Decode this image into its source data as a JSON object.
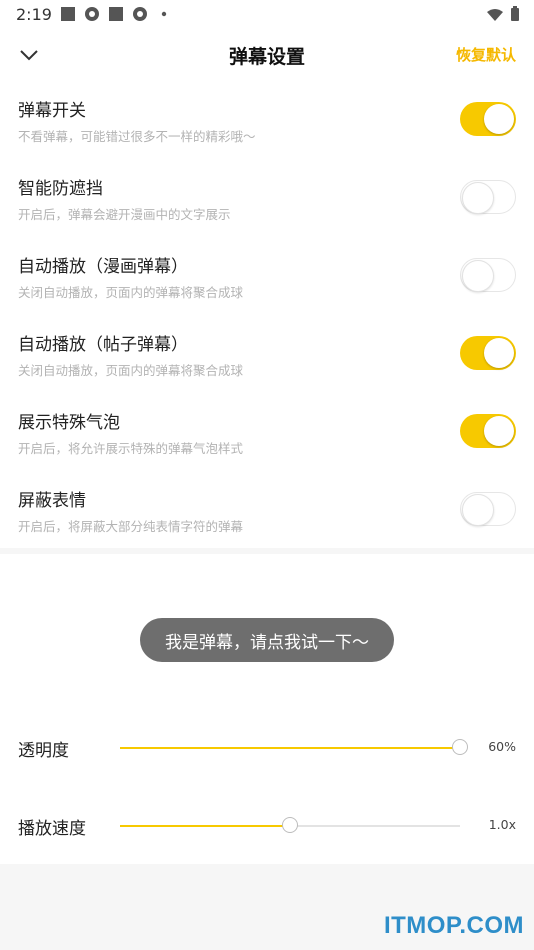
{
  "status_bar": {
    "time": "2:19"
  },
  "header": {
    "title": "弹幕设置",
    "restore_label": "恢复默认"
  },
  "settings": [
    {
      "label": "弹幕开关",
      "desc": "不看弹幕，可能错过很多不一样的精彩哦～",
      "enabled": true
    },
    {
      "label": "智能防遮挡",
      "desc": "开启后，弹幕会避开漫画中的文字展示",
      "enabled": false
    },
    {
      "label": "自动播放（漫画弹幕）",
      "desc": "关闭自动播放，页面内的弹幕将聚合成球",
      "enabled": false
    },
    {
      "label": "自动播放（帖子弹幕）",
      "desc": "关闭自动播放，页面内的弹幕将聚合成球",
      "enabled": true
    },
    {
      "label": "展示特殊气泡",
      "desc": "开启后，将允许展示特殊的弹幕气泡样式",
      "enabled": true
    },
    {
      "label": "屏蔽表情",
      "desc": "开启后，将屏蔽大部分纯表情字符的弹幕",
      "enabled": false
    }
  ],
  "preview": {
    "bubble_text": "我是弹幕，请点我试一下～"
  },
  "sliders": [
    {
      "label": "透明度",
      "value_text": "60%",
      "fraction": 1.0
    },
    {
      "label": "播放速度",
      "value_text": "1.0x",
      "fraction": 0.5
    }
  ],
  "watermark": "ITMOP.COM",
  "colors": {
    "accent": "#f7c900",
    "restore": "#f5b800",
    "bubble": "#6e6e6e"
  }
}
